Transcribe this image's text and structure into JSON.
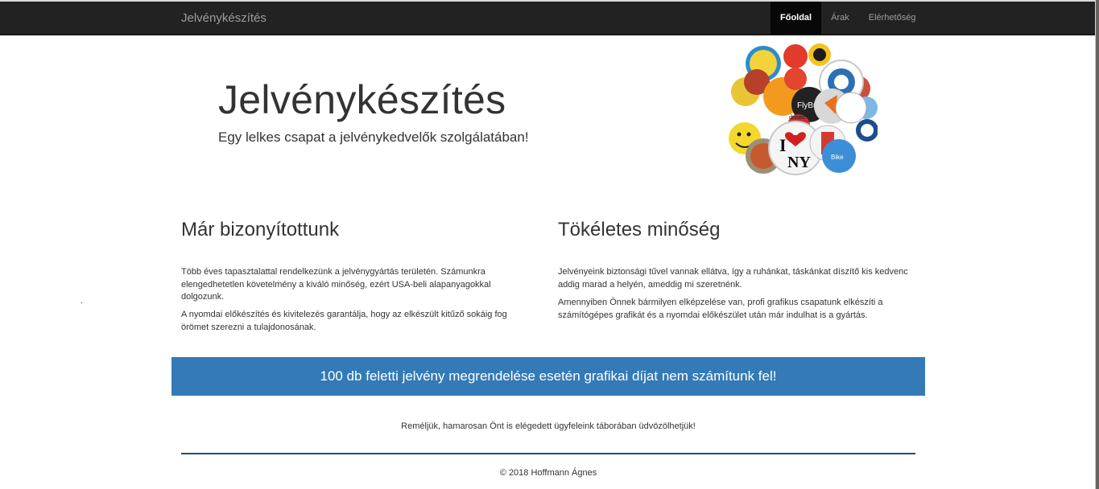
{
  "navbar": {
    "brand": "Jelvénykészítés",
    "items": [
      {
        "label": "Főoldal",
        "active": true
      },
      {
        "label": "Árak",
        "active": false
      },
      {
        "label": "Elérhetőség",
        "active": false
      }
    ]
  },
  "hero": {
    "title": "Jelvénykészítés",
    "subtitle": "Egy lelkes csapat a jelvénykedvelők szolgálatában!",
    "image": "pin-badges-collage",
    "badge_texts": {
      "flybuy": "FlyBuy",
      "dream": "dream",
      "i": "I",
      "ny": "NY",
      "bike": "Bike"
    }
  },
  "columns": [
    {
      "title": "Már bizonyítottunk",
      "paragraphs": [
        "Több éves tapasztalattal rendelkezünk a jelvénygyártás területén. Számunkra elengedhetetlen követelmény a kiváló minőség, ezért USA-beli alapanyagokkal dolgozunk.",
        "A nyomdai előkészítés és kivitelezés garantálja, hogy az elkészült kitűző sokáig fog örömet szerezni a tulajdonosának."
      ]
    },
    {
      "title": "Tökéletes minőség",
      "paragraphs": [
        "Jelvényeink biztonsági tűvel vannak ellátva, így a ruhánkat, táskánkat díszítő kis kedvenc addig marad a helyén, ameddig mi szeretnénk.",
        "Amennyiben Önnek bármilyen elképzelése van, profi grafikus csapatunk elkészíti a számítógépes grafikát és a nyomdai előkészület után már indulhat is a gyártás."
      ]
    }
  ],
  "stray_mark": ".",
  "banner": "100 db feletti jelvény megrendelése esetén grafikai díjat nem számítunk fel!",
  "closing": "Reméljük, hamarosan Önt is elégedett ügyfeleink táborában üdvözölhetjük!",
  "footer": "© 2018 Hoffmann Ágnes",
  "colors": {
    "navbar_bg": "#222222",
    "nav_active_bg": "#080808",
    "banner_bg": "#337ab7",
    "divider": "#264d6e"
  }
}
